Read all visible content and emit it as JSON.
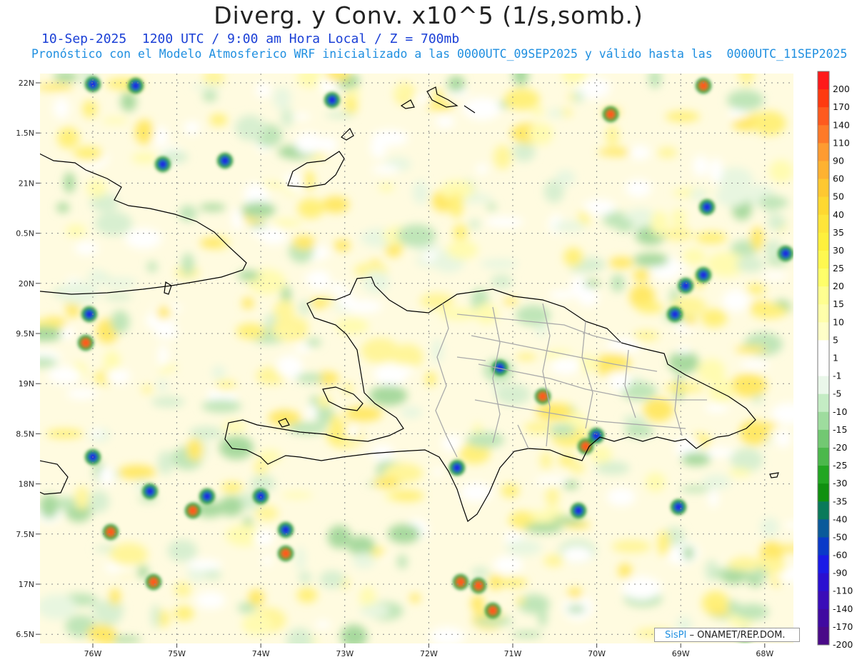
{
  "header": {
    "title": "Diverg. y Conv. x10^5 (1/s,somb.)",
    "line1": "10-Sep-2025  1200 UTC / 9:00 am Hora Local / Z = 700mb",
    "line2": "Pronóstico con el Modelo Atmosferico WRF inicializado a las 0000UTC_09SEP2025 y válido hasta las  0000UTC_11SEP2025"
  },
  "axes": {
    "lat_labels": [
      "22N",
      "1.5N",
      "21N",
      "0.5N",
      "20N",
      "9.5N",
      "19N",
      "8.5N",
      "18N",
      "7.5N",
      "17N",
      "6.5N"
    ],
    "lon_labels": [
      "76W",
      "75W",
      "74W",
      "73W",
      "72W",
      "71W",
      "70W",
      "69W",
      "68W"
    ]
  },
  "colorbar": {
    "labels": [
      "200",
      "170",
      "140",
      "110",
      "90",
      "60",
      "50",
      "40",
      "35",
      "30",
      "25",
      "20",
      "15",
      "10",
      "5",
      "1",
      "-1",
      "-5",
      "-10",
      "-15",
      "-20",
      "-25",
      "-30",
      "-35",
      "-40",
      "-50",
      "-60",
      "-90",
      "-110",
      "-140",
      "-170",
      "-200"
    ],
    "colors": [
      "#ff1a1a",
      "#ff3a10",
      "#ff5a1e",
      "#ff7a28",
      "#ff9b30",
      "#ffb230",
      "#ffc830",
      "#ffd830",
      "#ffe53a",
      "#fff03c",
      "#fff850",
      "#ffff6a",
      "#ffff90",
      "#ffffaa",
      "#ffffc8",
      "#ffffff",
      "#ffffff",
      "#eaf7ea",
      "#c4ecc4",
      "#9edc9e",
      "#72c872",
      "#4cb84c",
      "#22a622",
      "#109010",
      "#0a7a5a",
      "#0a5a9a",
      "#0a3ac8",
      "#1a1ae6",
      "#2a10d0",
      "#3a0cb8",
      "#400aa0",
      "#4a0a88"
    ]
  },
  "credit": {
    "brand": "SisPI",
    "text": "ONAMET/REP.DOM."
  },
  "colors": {
    "land_border": "#000000",
    "province_border": "#aaaaaa",
    "graticule": "#888888"
  }
}
